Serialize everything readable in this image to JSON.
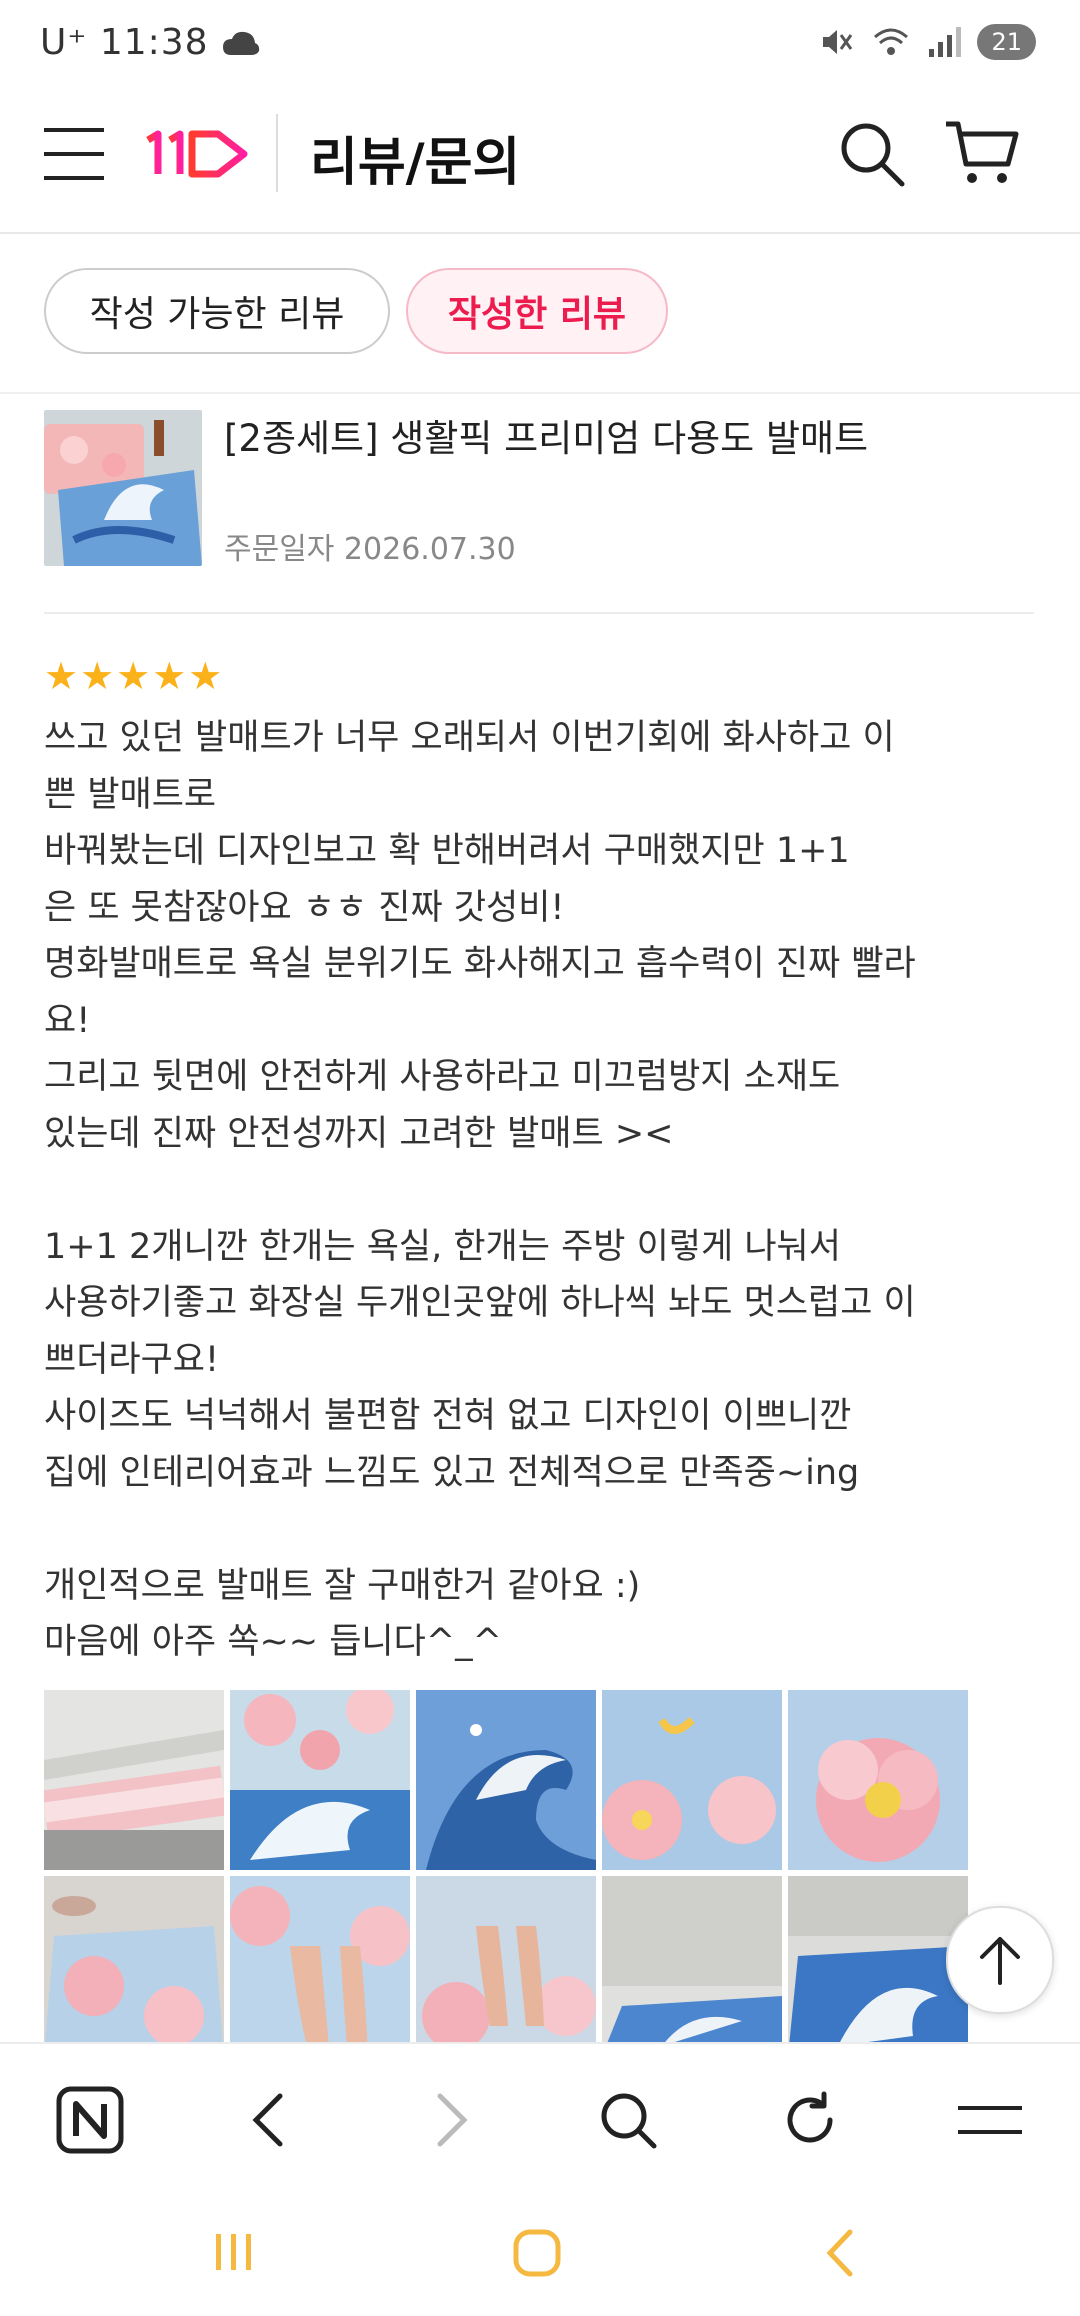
{
  "status_bar": {
    "time": "11:38",
    "carrier": "U⁺",
    "battery": "21"
  },
  "header": {
    "brand": "11번가 logo",
    "title": "리뷰/문의"
  },
  "tabs": [
    {
      "label": "작성 가능한 리뷰"
    },
    {
      "label": "작성한 리뷰"
    }
  ],
  "product": {
    "name": "[2종세트] 생활픽 프리미엄 다용도 발매트",
    "order_date": "주문일자 2026.07.30"
  },
  "review": {
    "stars": "★★★★★",
    "text": "쓰고 있던 발매트가 너무 오래되서 이번기회에 화사하고 이\n쁜 발매트로\n바꿔봤는데 디자인보고 확 반해버려서 구매했지만 1+1\n은 또 못참잖아요 ㅎㅎ 진짜 갓성비!\n명화발매트로 욕실 분위기도 화사해지고 흡수력이 진짜 빨라\n요!\n그리고 뒷면에 안전하게 사용하라고 미끄럼방지 소재도\n있는데 진짜 안전성까지 고려한 발매트 ><\n\n1+1 2개니깐 한개는 욕실, 한개는 주방 이렇게 나눠서\n사용하기좋고 화장실 두개인곳앞에 하나씩 놔도 멋스럽고 이\n쁘더라구요!\n사이즈도 넉넉해서 불편함 전혀 없고 디자인이 이쁘니깐\n집에 인테리어효과 느낌도 있고 전체적으로 만족중~ing\n\n개인적으로 발매트 잘 구매한거 같아요 :)\n마음에 아주 쏙~~ 듭니다^_^"
  },
  "photos": [
    {
      "kind": "rolled-mat"
    },
    {
      "kind": "wave-lotus"
    },
    {
      "kind": "wave"
    },
    {
      "kind": "lotus-moon"
    },
    {
      "kind": "lotus"
    },
    {
      "kind": "floor-lotus"
    },
    {
      "kind": "feet-lotus"
    },
    {
      "kind": "feet-lotus2"
    },
    {
      "kind": "floor-wave"
    },
    {
      "kind": "floor-wave2"
    }
  ],
  "colors": {
    "accent": "#ec1c4f",
    "star": "#fbb11a"
  }
}
